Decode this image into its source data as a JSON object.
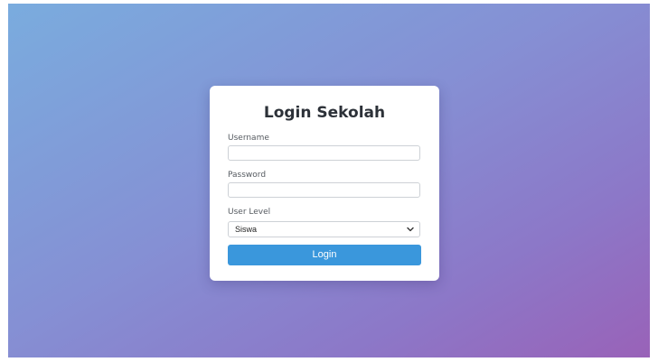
{
  "login": {
    "title": "Login Sekolah",
    "username_label": "Username",
    "username_value": "",
    "password_label": "Password",
    "password_value": "",
    "level_label": "User Level",
    "level_selected": "Siswa",
    "button_label": "Login"
  },
  "icons": {
    "select_arrow": "chevron-down-icon"
  },
  "colors": {
    "button": "#3a97dc",
    "gradient_start": "#7aacde",
    "gradient_end": "#9962b8"
  }
}
